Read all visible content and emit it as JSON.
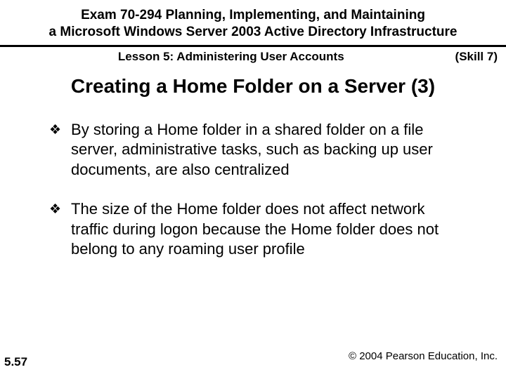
{
  "header": {
    "title_line1": "Exam 70-294 Planning, Implementing, and Maintaining",
    "title_line2": "a Microsoft Windows Server 2003 Active Directory Infrastructure"
  },
  "subheader": {
    "lesson": "Lesson 5: Administering User Accounts",
    "skill": "(Skill 7)"
  },
  "slide_title": "Creating a Home Folder on a Server (3)",
  "bullets": [
    "By storing a Home folder in a shared folder on a file server, administrative tasks, such as backing up user documents, are also centralized",
    "The size of the Home folder does not affect network traffic during logon because the Home folder does not belong to any roaming user profile"
  ],
  "footer": {
    "page_number": "5.57",
    "copyright": "© 2004 Pearson Education, Inc."
  }
}
